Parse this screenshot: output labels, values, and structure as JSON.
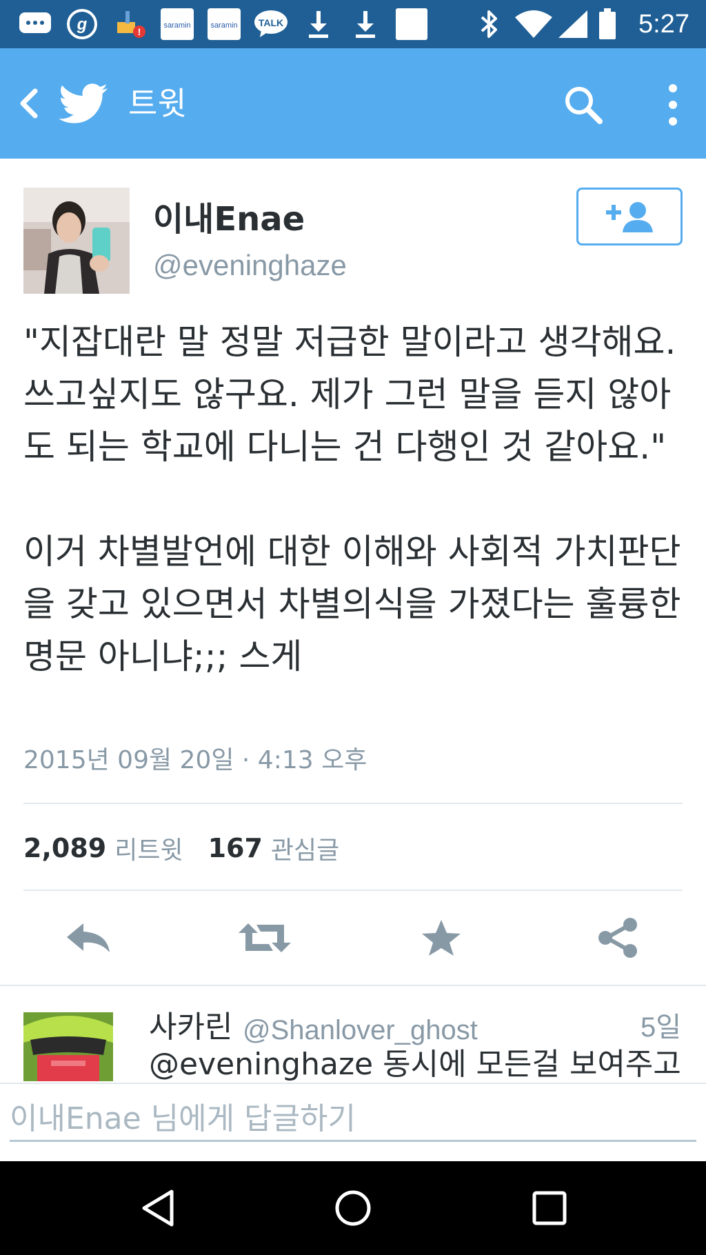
{
  "status_bar": {
    "time": "5:27",
    "icons": [
      "chat-bubble-icon",
      "g-app-icon",
      "cleaner-icon",
      "saramin-icon",
      "saramin-icon",
      "kakaotalk-icon",
      "download-icon",
      "download-icon",
      "blank-notification-icon",
      "bluetooth-icon",
      "wifi-icon",
      "signal-icon",
      "battery-icon"
    ],
    "talk_label": "TALK",
    "saramin_label": "saramin"
  },
  "app_bar": {
    "title": "트윗",
    "color": "#55acee"
  },
  "tweet": {
    "author_name": "이내Enae",
    "author_handle": "@eveninghaze",
    "text": "\"지잡대란 말 정말 저급한 말이라고 생각해요. 쓰고싶지도 않구요. 제가 그런 말을 듣지 않아도 되는 학교에 다니는 건 다행인 것 같아요.\"\n\n이거 차별발언에 대한 이해와 사회적 가치판단을 갖고 있으면서 차별의식을 가졌다는 훌륭한 명문 아니냐;;; 스게",
    "timestamp": "2015년 09월 20일 · 4:13 오후",
    "retweet_count": "2,089",
    "retweet_label": "리트윗",
    "favorite_count": "167",
    "favorite_label": "관심글"
  },
  "actions": [
    "reply-icon",
    "retweet-icon",
    "favorite-icon",
    "share-icon"
  ],
  "reply_preview": {
    "name": "사카린",
    "handle": "@Shanlover_ghost",
    "time": "5일",
    "text": "@eveninghaze 동시에 모든걸 보여주고"
  },
  "compose": {
    "placeholder": "이내Enae 님에게 답글하기"
  },
  "nav_bar": {
    "buttons": [
      "back-icon",
      "home-icon",
      "recents-icon"
    ]
  }
}
